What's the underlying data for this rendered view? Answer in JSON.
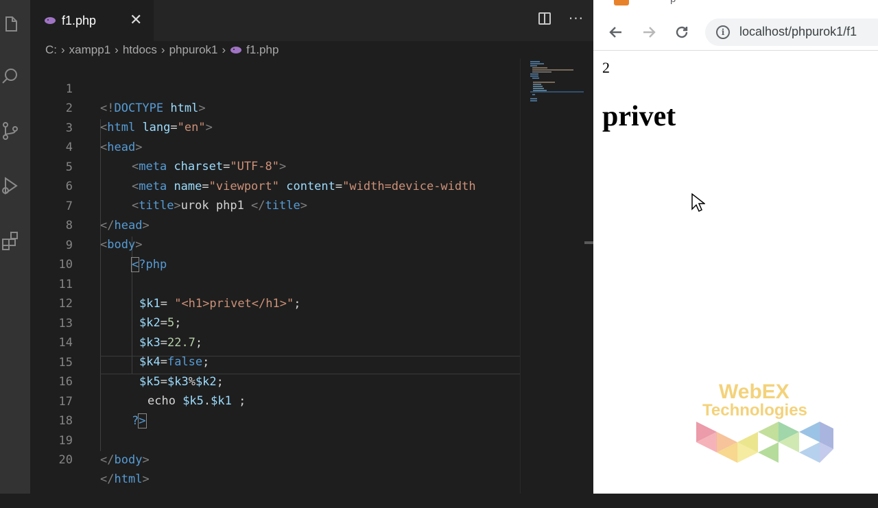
{
  "editor": {
    "tab": {
      "label": "f1.php",
      "close": "✕"
    },
    "actions": {
      "more": "···"
    },
    "breadcrumb": [
      "C:",
      "xampp1",
      "htdocs",
      "phpurok1",
      "f1.php"
    ],
    "line_numbers": [
      "1",
      "2",
      "3",
      "4",
      "5",
      "6",
      "7",
      "8",
      "9",
      "10",
      "11",
      "12",
      "13",
      "14",
      "15",
      "16",
      "17",
      "18",
      "19",
      "20"
    ],
    "code": {
      "l1": {
        "a": "<!",
        "b": "DOCTYPE",
        "c": " html",
        "d": ">"
      },
      "l2": {
        "a": "<",
        "b": "html",
        "c": " lang",
        "d": "=",
        "e": "\"en\"",
        "f": ">"
      },
      "l3": {
        "a": "<",
        "b": "head",
        "c": ">"
      },
      "l4": {
        "a": "<",
        "b": "meta",
        "c": " charset",
        "d": "=",
        "e": "\"UTF-8\"",
        "f": ">"
      },
      "l5": {
        "a": "<",
        "b": "meta",
        "c": " name",
        "d": "=",
        "e": "\"viewport\"",
        "f": " content",
        "g": "=",
        "h": "\"width=device-width"
      },
      "l6": {
        "a": "<",
        "b": "title",
        "c": ">",
        "d": "urok php1 ",
        "e": "</",
        "f": "title",
        "g": ">"
      },
      "l7": {
        "a": "</",
        "b": "head",
        "c": ">"
      },
      "l8": {
        "a": "<",
        "b": "body",
        "c": ">"
      },
      "l9": {
        "a": "<",
        "b": "?php"
      },
      "l11": {
        "a": "$k1",
        "b": "= ",
        "c": "\"<h1>privet</h1>\"",
        "d": ";"
      },
      "l12": {
        "a": "$k2",
        "b": "=",
        "c": "5",
        "d": ";"
      },
      "l13": {
        "a": "$k3",
        "b": "=",
        "c": "22.7",
        "d": ";"
      },
      "l14": {
        "a": "$k4",
        "b": "=",
        "c": "false",
        "d": ";"
      },
      "l15": {
        "a": "$k5",
        "b": "=",
        "c": "$k3",
        "d": "%",
        "e": "$k2",
        "f": ";"
      },
      "l16": {
        "a": "echo ",
        "b": "$k5",
        "c": ".",
        "d": "$k1",
        "e": " ;"
      },
      "l17": {
        "a": "?",
        "b": ">"
      },
      "l19": {
        "a": "</",
        "b": "body",
        "c": ">"
      },
      "l20": {
        "a": "</",
        "b": "html",
        "c": ">"
      }
    }
  },
  "browser": {
    "tab_title": "p",
    "url": "localhost/phpurok1/f1",
    "page": {
      "output_number": "2",
      "heading": "privet"
    },
    "logo": {
      "line1": "WebEX",
      "line2": "Technologies"
    }
  },
  "colors": {
    "editor_bg": "#1e1e1e",
    "tag_blue": "#569cd6",
    "attr": "#9cdcfe",
    "string": "#ce9178",
    "number": "#b5cea8",
    "logo_gold": "#f4d27a"
  },
  "icons": [
    "files-icon",
    "search-icon",
    "source-control-icon",
    "run-debug-icon",
    "extensions-icon",
    "php-elephant-icon",
    "split-editor-icon",
    "more-actions-icon",
    "back-arrow-icon",
    "forward-arrow-icon",
    "reload-icon",
    "site-info-icon",
    "mouse-pointer-icon"
  ]
}
